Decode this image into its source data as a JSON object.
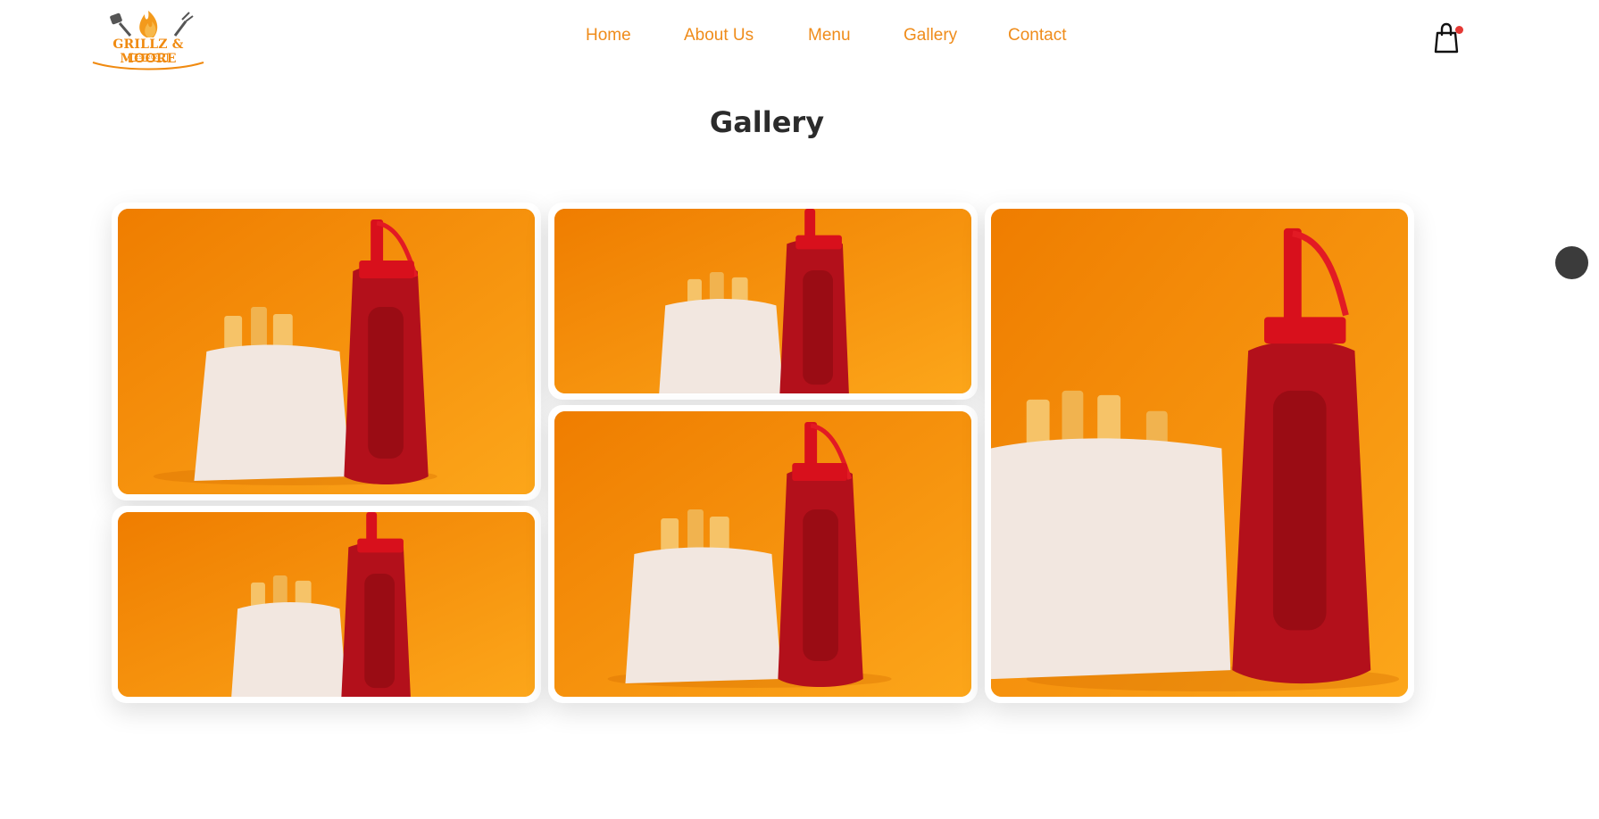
{
  "brand": {
    "logo_text": "GRILLZ & MOORE",
    "logo_subtext": "EST 2022",
    "accent_color": "#ef8c1b"
  },
  "nav": {
    "items": [
      {
        "label": "Home"
      },
      {
        "label": "About Us"
      },
      {
        "label": "Menu"
      },
      {
        "label": "Gallery"
      },
      {
        "label": "Contact"
      }
    ]
  },
  "cart": {
    "icon": "shopping-bag-icon",
    "badge_color": "#e53935"
  },
  "page": {
    "title": "Gallery"
  },
  "gallery": {
    "images": [
      {
        "subject": "fries-and-ketchup-bottle"
      },
      {
        "subject": "fries-and-ketchup-bottle"
      },
      {
        "subject": "fries-and-ketchup-bottle"
      },
      {
        "subject": "fries-and-ketchup-bottle"
      },
      {
        "subject": "fries-and-ketchup-bottle"
      }
    ]
  },
  "side_handle": {
    "icon": "circle-handle-icon"
  }
}
